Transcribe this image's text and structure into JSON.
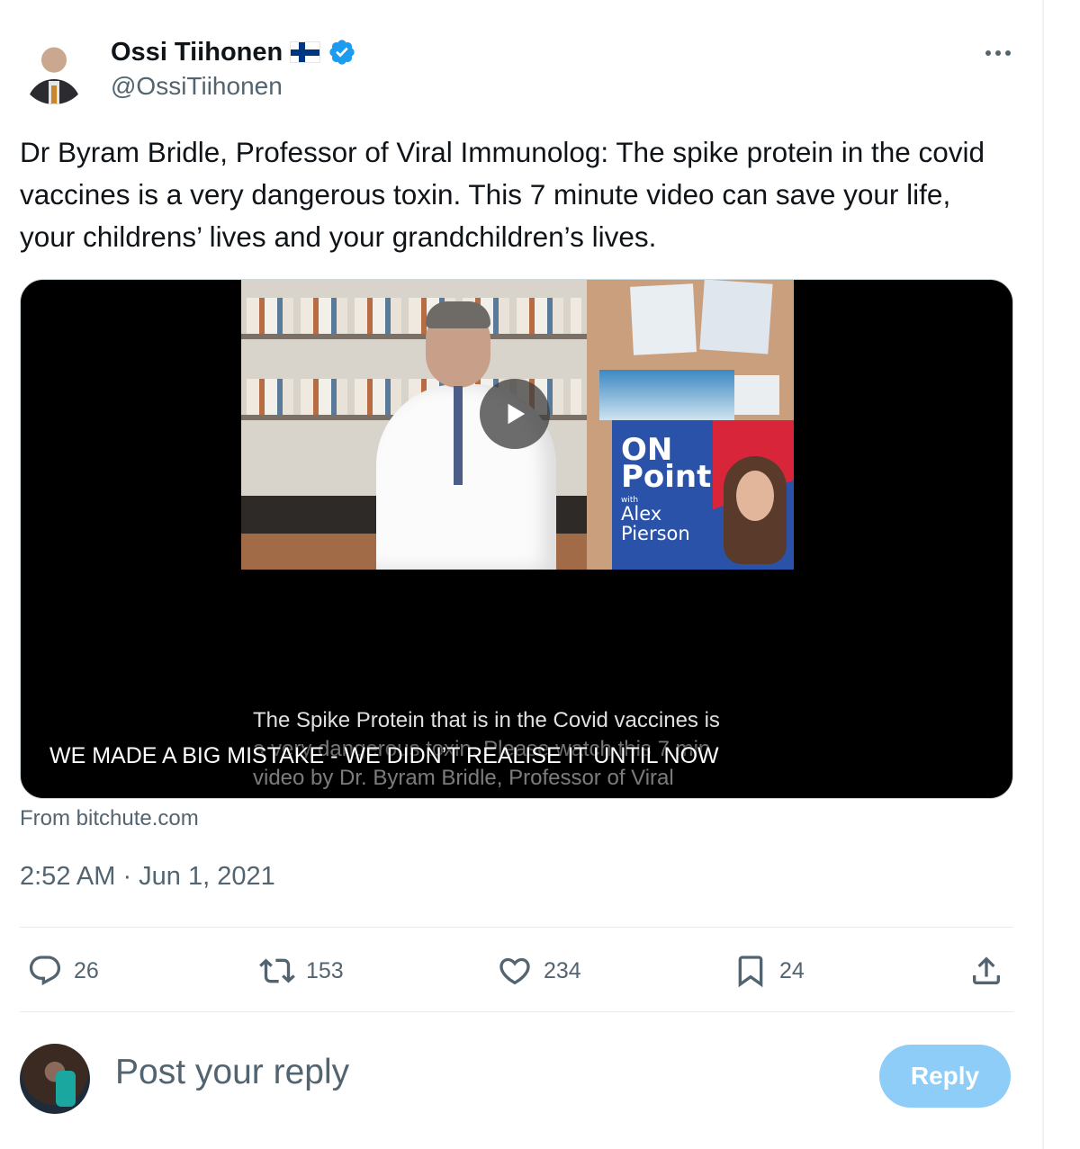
{
  "author": {
    "name": "Ossi Tiihonen",
    "handle": "@OssiTiihonen",
    "flag": "finland-flag",
    "verified": true
  },
  "tweet": {
    "text": "Dr Byram Bridle, Professor of Viral Immunolog: The spike protein in the covid vaccines is a very dangerous toxin. This 7 minute video can save your life, your childrens’ lives and your grandchildren’s lives.",
    "video": {
      "title": "WE MADE A BIG MISTAKE - WE DIDN’T REALISE IT UNTIL NOW",
      "thumbnail_caption_line1": "The Spike Protein that is in the Covid vaccines is",
      "thumbnail_caption_line2": "a very dangerous toxin. Please watch this 7 min",
      "thumbnail_caption_line3": "video by Dr. Byram Bridle, Professor of Viral",
      "badge_on": "ON",
      "badge_point": "Point",
      "badge_with": "with",
      "badge_alex": "Alex",
      "badge_pierson": "Pierson"
    },
    "source": "From bitchute.com",
    "timestamp": "2:52 AM · Jun 1, 2021"
  },
  "actions": {
    "replies": "26",
    "retweets": "153",
    "likes": "234",
    "bookmarks": "24"
  },
  "reply_box": {
    "placeholder": "Post your reply",
    "button_label": "Reply"
  },
  "colors": {
    "accent": "#1d9bf0",
    "reply_button_disabled": "#8ecdf8",
    "muted_text": "#536471"
  }
}
